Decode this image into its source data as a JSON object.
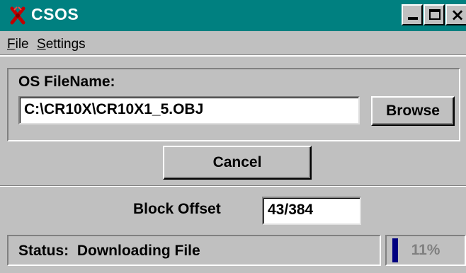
{
  "window": {
    "title": "CSOS",
    "icon": "app-plug-icon",
    "controls": {
      "minimize": "minimize-icon",
      "maximize": "maximize-icon",
      "close": "close-icon"
    }
  },
  "menu": {
    "file_mnemonic": "F",
    "file_rest": "ile",
    "settings_mnemonic": "S",
    "settings_rest": "ettings"
  },
  "os_file": {
    "label": "OS FileName:",
    "value": "C:\\CR10X\\CR10X1_5.OBJ",
    "browse_label": "Browse"
  },
  "cancel_label": "Cancel",
  "block_offset": {
    "label": "Block Offset",
    "value": "43/384"
  },
  "status": {
    "text": "Status:  Downloading File",
    "progress_percent": 11,
    "progress_label": "11%"
  },
  "colors": {
    "titlebar": "#008080",
    "face": "#c0c0c0",
    "progress": "#000080",
    "icon_red": "#c00000"
  }
}
